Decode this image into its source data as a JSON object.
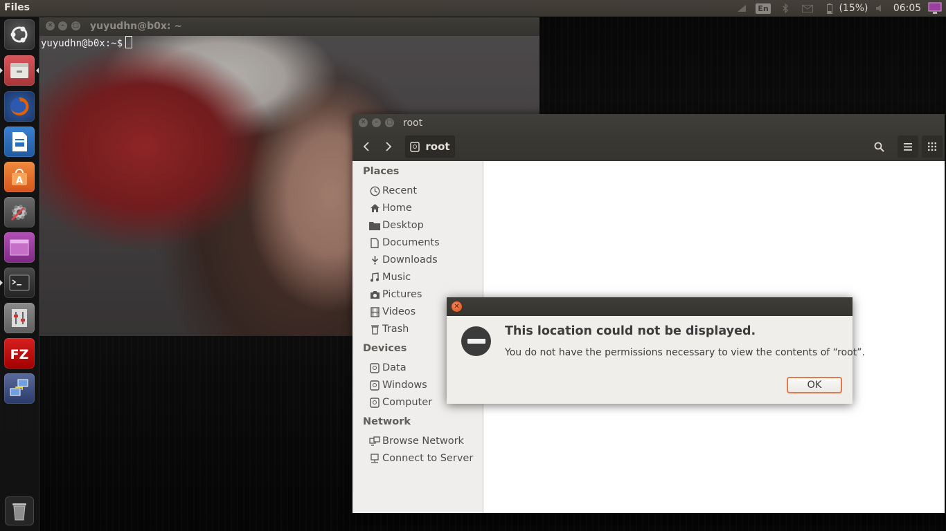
{
  "top_panel": {
    "app_name": "Files",
    "keyboard_layout": "En",
    "battery_percent": "(15%)",
    "clock": "06:05"
  },
  "launcher": {
    "items": [
      {
        "name": "ubuntu-dash-icon",
        "color": "#e2e2e2"
      },
      {
        "name": "files-app-icon",
        "color": "#c8464a"
      },
      {
        "name": "firefox-icon",
        "color": "#e66000"
      },
      {
        "name": "libreoffice-writer-icon",
        "color": "#2a6ebc"
      },
      {
        "name": "software-center-icon",
        "color": "#e95420"
      },
      {
        "name": "system-settings-icon",
        "color": "#5a5a5a"
      },
      {
        "name": "workspace-switcher-icon",
        "color": "#9b3fa0"
      },
      {
        "name": "terminal-icon",
        "color": "#2c2c2c"
      },
      {
        "name": "sound-mixer-icon",
        "color": "#6e6e6e"
      },
      {
        "name": "filezilla-icon",
        "color": "#bf0000"
      },
      {
        "name": "remote-desktop-icon",
        "color": "#2a3a6a"
      }
    ],
    "trash": "trash-icon"
  },
  "terminal": {
    "title": "yuyudhn@b0x: ~",
    "prompt": "yuyudhn@b0x:~$"
  },
  "files": {
    "title": "root",
    "path_button": "root",
    "sidebar": {
      "places_heading": "Places",
      "places": [
        {
          "label": "Recent",
          "icon": "clock-icon"
        },
        {
          "label": "Home",
          "icon": "home-icon"
        },
        {
          "label": "Desktop",
          "icon": "folder-icon"
        },
        {
          "label": "Documents",
          "icon": "document-icon"
        },
        {
          "label": "Downloads",
          "icon": "download-icon"
        },
        {
          "label": "Music",
          "icon": "music-icon"
        },
        {
          "label": "Pictures",
          "icon": "camera-icon"
        },
        {
          "label": "Videos",
          "icon": "film-icon"
        },
        {
          "label": "Trash",
          "icon": "trash-icon"
        }
      ],
      "devices_heading": "Devices",
      "devices": [
        {
          "label": "Data",
          "icon": "drive-icon"
        },
        {
          "label": "Windows",
          "icon": "drive-icon"
        },
        {
          "label": "Computer",
          "icon": "drive-icon"
        }
      ],
      "network_heading": "Network",
      "network": [
        {
          "label": "Browse Network",
          "icon": "network-icon"
        },
        {
          "label": "Connect to Server",
          "icon": "server-icon"
        }
      ]
    }
  },
  "dialog": {
    "heading": "This location could not be displayed.",
    "message": "You do not have the permissions necessary to view the contents of “root”.",
    "ok_label": "OK",
    "accent": "#e27a4e"
  }
}
